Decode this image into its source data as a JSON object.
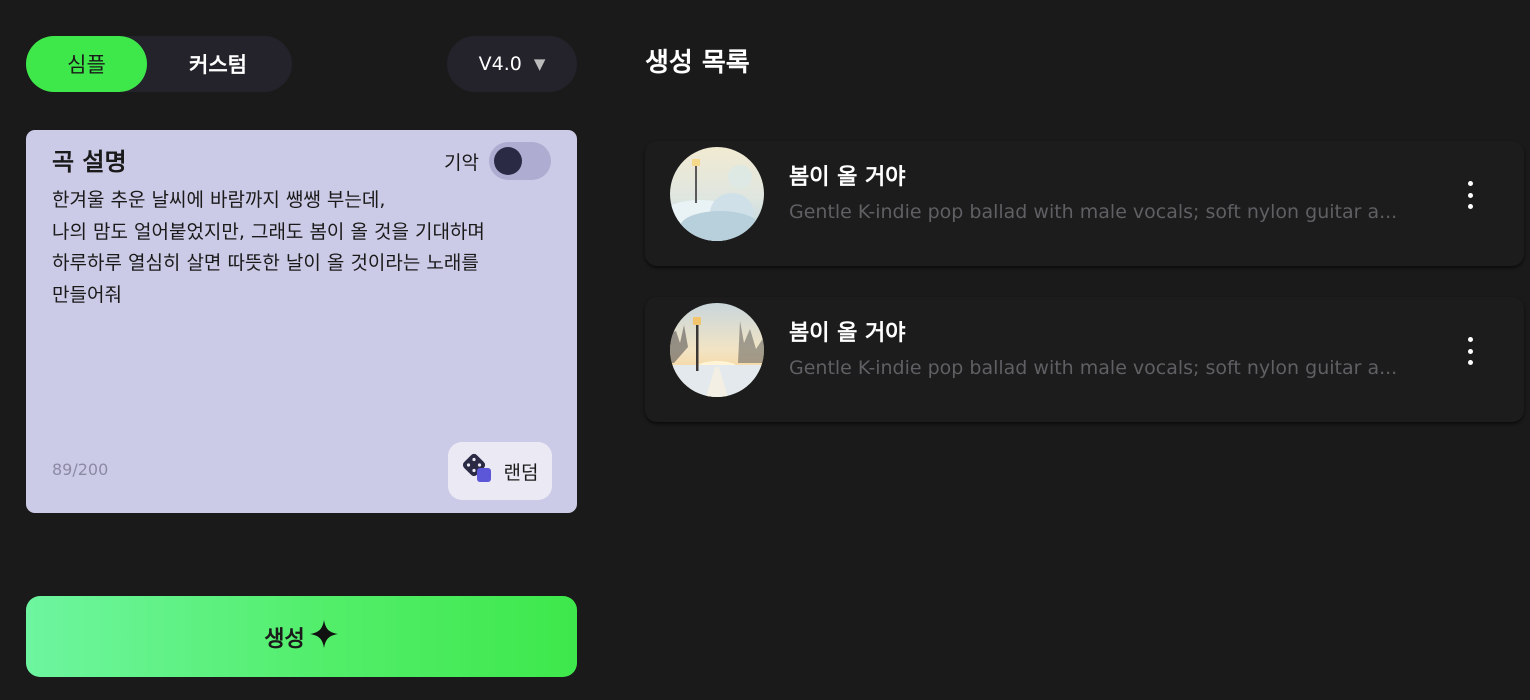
{
  "mode_toggle": {
    "simple_label": "심플",
    "custom_label": "커스텀",
    "active": "simple"
  },
  "version": {
    "label": "V4.0"
  },
  "description_card": {
    "title": "곡 설명",
    "instrumental_label": "기악",
    "instrumental_on": false,
    "text": "한겨울 추운 날씨에 바람까지 쌩쌩 부는데,\n나의 맘도 얼어붙었지만, 그래도 봄이 올 것을 기대하며\n하루하루 열심히 살면 따뜻한 날이 올 것이라는 노래를\n만들어줘",
    "char_count": "89/200",
    "random_label": "랜덤"
  },
  "generate_button": {
    "label": "생성"
  },
  "song_list": {
    "title": "생성 목록",
    "items": [
      {
        "title": "봄이 올 거야",
        "description": "Gentle K-indie pop ballad with male vocals; soft nylon guitar a..."
      },
      {
        "title": "봄이 올 거야",
        "description": "Gentle K-indie pop ballad with male vocals; soft nylon guitar a..."
      }
    ]
  },
  "colors": {
    "accent_green": "#3ee84b",
    "card_lavender": "#cccbe7",
    "background": "#1a1a1a"
  }
}
